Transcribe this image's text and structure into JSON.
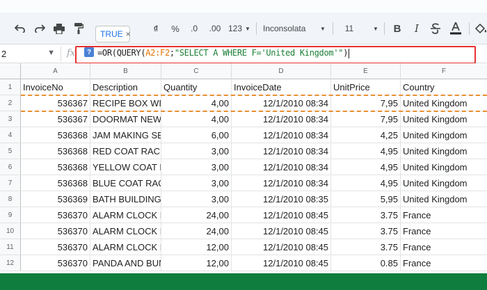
{
  "toolbar": {
    "true_chip": "TRUE",
    "true_chip_close": "×",
    "percent": "%",
    "decimal_decrease": ".0",
    "decimal_increase": ".00",
    "number_format": "123",
    "font_family": "Inconsolata",
    "font_size": "11",
    "bold": "B",
    "italic": "I"
  },
  "formula_bar": {
    "name_box": "2",
    "fx": "fx",
    "query_icon": "?",
    "formula_prefix": "=OR(QUERY(",
    "formula_range": "A2:F2",
    "formula_sep": ";",
    "formula_string": "\"SELECT A WHERE F='United Kingdom'\"",
    "formula_suffix": ")"
  },
  "grid": {
    "columns": [
      "A",
      "B",
      "C",
      "D",
      "E",
      "F"
    ],
    "row_numbers": [
      "1",
      "2",
      "3",
      "4",
      "5",
      "6",
      "7",
      "8",
      "9",
      "10",
      "11",
      "12"
    ],
    "header": [
      "InvoiceNo",
      "Description",
      "Quantity",
      "InvoiceDate",
      "UnitPrice",
      "Country"
    ],
    "rows": [
      [
        "536367",
        "RECIPE BOX WIT",
        "4,00",
        "12/1/2010 08:34",
        "7,95",
        "United Kingdom"
      ],
      [
        "536367",
        "DOORMAT NEW",
        "4,00",
        "12/1/2010 08:34",
        "7,95",
        "United Kingdom"
      ],
      [
        "536368",
        "JAM MAKING SE",
        "6,00",
        "12/1/2010 08:34",
        "4,25",
        "United Kingdom"
      ],
      [
        "536368",
        "RED COAT RACK",
        "3,00",
        "12/1/2010 08:34",
        "4,95",
        "United Kingdom"
      ],
      [
        "536368",
        "YELLOW COAT R",
        "3,00",
        "12/1/2010 08:34",
        "4,95",
        "United Kingdom"
      ],
      [
        "536368",
        "BLUE COAT RACK",
        "3,00",
        "12/1/2010 08:34",
        "4,95",
        "United Kingdom"
      ],
      [
        "536369",
        "BATH BUILDING",
        "3,00",
        "12/1/2010 08:35",
        "5,95",
        "United Kingdom"
      ],
      [
        "536370",
        "ALARM CLOCK B",
        "24,00",
        "12/1/2010 08:45",
        "3.75",
        "France"
      ],
      [
        "536370",
        "ALARM CLOCK B",
        "24,00",
        "12/1/2010 08:45",
        "3.75",
        "France"
      ],
      [
        "536370",
        "ALARM CLOCK B",
        "12,00",
        "12/1/2010 08:45",
        "3.75",
        "France"
      ],
      [
        "536370",
        "PANDA AND BUN",
        "12,00",
        "12/1/2010 08:45",
        "0.85",
        "France"
      ]
    ]
  }
}
